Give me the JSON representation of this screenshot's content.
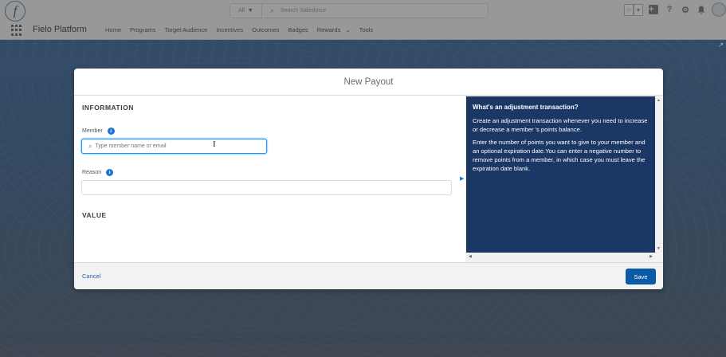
{
  "header": {
    "logo_letter": "f",
    "search_scope": "All",
    "search_placeholder": "Search Salesforce",
    "favorites_star": "☆",
    "favorites_caret": "▾",
    "icons": [
      "plus-icon",
      "help-icon",
      "gear-icon",
      "bell-icon",
      "avatar"
    ]
  },
  "nav": {
    "app_name": "Fielo Platform",
    "items": [
      {
        "label": "Home"
      },
      {
        "label": "Programs"
      },
      {
        "label": "Target Audience"
      },
      {
        "label": "Incentives"
      },
      {
        "label": "Outcomes"
      },
      {
        "label": "Badges"
      },
      {
        "label": "Rewards"
      },
      {
        "label": "Tools"
      }
    ],
    "rewards_caret": "⌄"
  },
  "modal": {
    "title": "New Payout",
    "information_heading": "INFORMATION",
    "member_label": "Member",
    "member_placeholder": "Type member name or email",
    "reason_label": "Reason",
    "reason_value": "",
    "value_heading": "VALUE",
    "help": {
      "title": "What's an adjustment transaction?",
      "p1": "Create an adjustment transaction whenever you need to increase or decrease a member 's points balance.",
      "p2": "Enter the number of points you want to give to your member and an optional expiration date.You can enter a negative number to remove points from a member, in which case you must leave the expiration date blank."
    },
    "cancel_label": "Cancel",
    "save_label": "Save"
  },
  "colors": {
    "save_button": "#0a5aa8",
    "help_panel": "#1b3766",
    "info_icon": "#1b73d4",
    "link": "#1b5fa8"
  }
}
